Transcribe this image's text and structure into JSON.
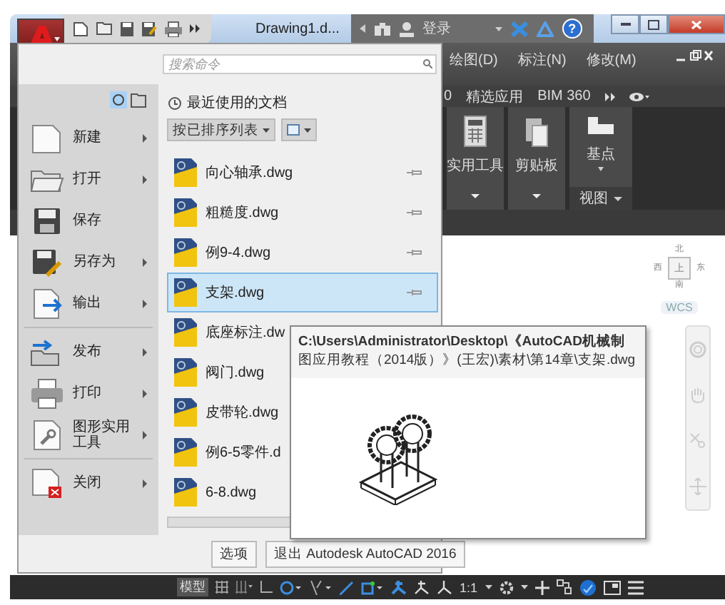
{
  "title_bar": {
    "title": "Drawing1.d...",
    "sign_in": "登录",
    "help": "?"
  },
  "menu_bar": [
    "绘图(D)",
    "标注(N)",
    "修改(M)"
  ],
  "ribbon_tabs": [
    "0",
    "精选应用",
    "BIM 360"
  ],
  "ribbon_panels": [
    {
      "label": "实用工具",
      "kind": "calculator"
    },
    {
      "label": "剪贴板",
      "kind": "clipboard"
    },
    {
      "label": "基点",
      "kind": "block"
    }
  ],
  "ribbon_panel_title": "视图",
  "viewcube": {
    "north": "北",
    "west": "西",
    "east": "东",
    "south": "南",
    "face": "上",
    "ucs": "WCS"
  },
  "status_bar": {
    "model": "模型",
    "scale": "1:1"
  },
  "app_menu": {
    "search_placeholder": "搜索命令",
    "commands": [
      {
        "label": "新建",
        "kind": "new",
        "submenu": true
      },
      {
        "label": "打开",
        "kind": "open",
        "submenu": true
      },
      {
        "label": "保存",
        "kind": "save",
        "submenu": false
      },
      {
        "label": "另存为",
        "kind": "saveas",
        "submenu": true
      },
      {
        "label": "输出",
        "kind": "export",
        "submenu": true,
        "divider_after": true
      },
      {
        "label": "发布",
        "kind": "publish",
        "submenu": true
      },
      {
        "label": "打印",
        "kind": "print",
        "submenu": true
      },
      {
        "label": "图形实用工具",
        "kind": "utilities",
        "submenu": true,
        "divider_after": true
      },
      {
        "label": "关闭",
        "kind": "close",
        "submenu": true
      }
    ],
    "recent_title": "最近使用的文档",
    "sort_label": "按已排序列表",
    "files": [
      {
        "name": "向心轴承.dwg",
        "selected": false,
        "pin": true
      },
      {
        "name": "粗糙度.dwg",
        "selected": false,
        "pin": true
      },
      {
        "name": "例9-4.dwg",
        "selected": false,
        "pin": true
      },
      {
        "name": "支架.dwg",
        "selected": true,
        "pin": true
      },
      {
        "name": "底座标注.dw",
        "selected": false,
        "pin": false
      },
      {
        "name": "阀门.dwg",
        "selected": false,
        "pin": false
      },
      {
        "name": "皮带轮.dwg",
        "selected": false,
        "pin": false
      },
      {
        "name": "例6-5零件.d",
        "selected": false,
        "pin": false
      },
      {
        "name": "6-8.dwg",
        "selected": false,
        "pin": false
      }
    ],
    "buttons": [
      "选项",
      "退出 Autodesk AutoCAD 2016"
    ]
  },
  "tooltip": {
    "path": "C:\\Users\\Administrator\\Desktop\\《AutoCAD机械制图应用教程（2014版）》(王宏)\\素材\\第14章\\支架.dwg"
  }
}
